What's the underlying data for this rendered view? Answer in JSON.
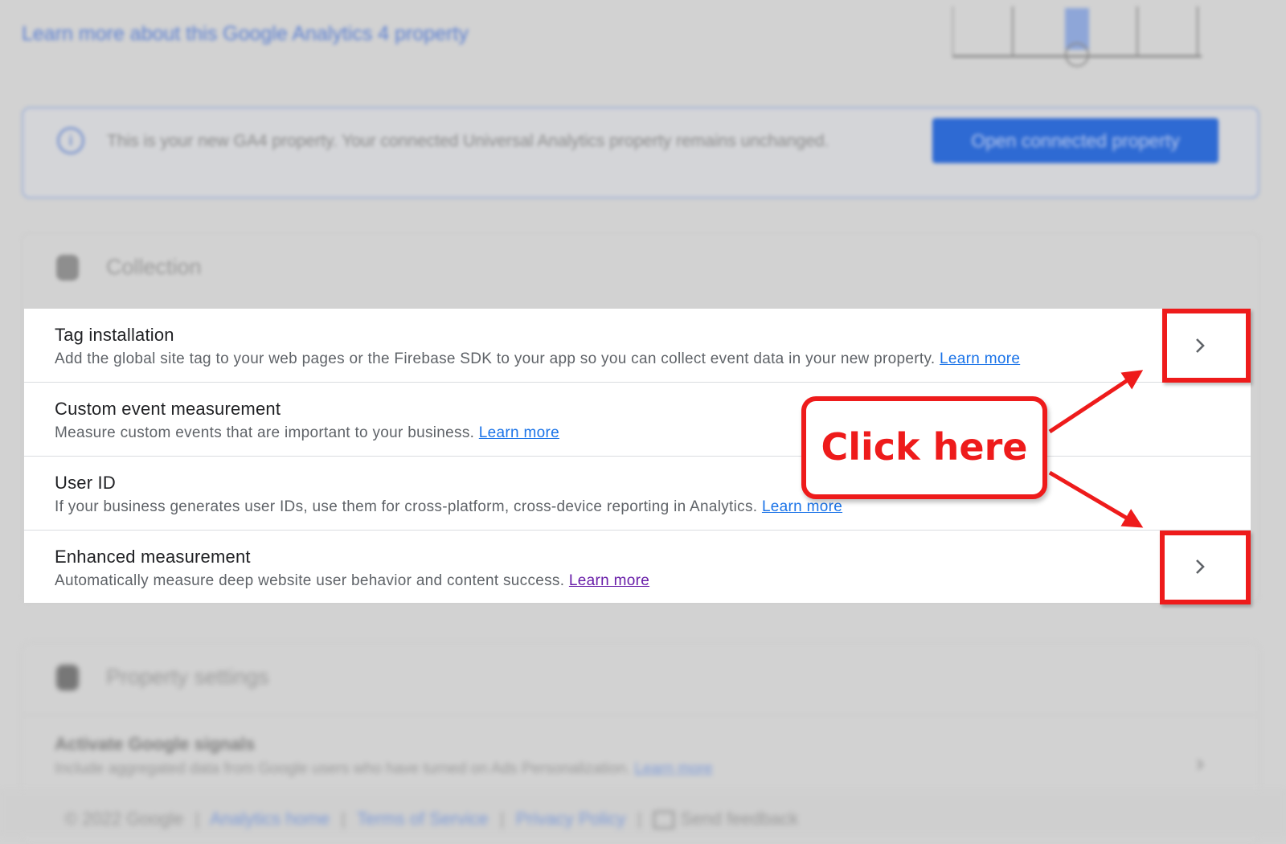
{
  "top": {
    "learn_more_link": "Learn more about this Google Analytics 4 property"
  },
  "banner": {
    "icon": "info-icon",
    "text": "This is your new GA4 property. Your connected Universal Analytics property remains unchanged.",
    "button_label": "Open connected property"
  },
  "collection": {
    "icon": "collection-icon",
    "title": "Collection",
    "rows": [
      {
        "title": "Tag installation",
        "description": "Add the global site tag to your web pages or the Firebase SDK to your app so you can collect event data in your new property.",
        "link": "Learn more"
      },
      {
        "title": "Custom event measurement",
        "description": "Measure custom events that are important to your business.",
        "link": "Learn more"
      },
      {
        "title": "User ID",
        "description": "If your business generates user IDs, use them for cross-platform, cross-device reporting in Analytics.",
        "link": "Learn more"
      },
      {
        "title": "Enhanced measurement",
        "description": "Automatically measure deep website user behavior and content success.",
        "link": "Learn more"
      }
    ]
  },
  "callout": {
    "text": "Click here",
    "color": "#ee1b1b"
  },
  "property_settings": {
    "icon": "database-icon",
    "title": "Property settings",
    "row_title": "Activate Google signals",
    "row_description": "Include aggregated data from Google users who have turned on Ads Personalization.",
    "row_link": "Learn more"
  },
  "footer": {
    "copyright": "© 2022 Google",
    "analytics_home": "Analytics home",
    "terms": "Terms of Service",
    "privacy": "Privacy Policy",
    "feedback": "Send feedback"
  }
}
